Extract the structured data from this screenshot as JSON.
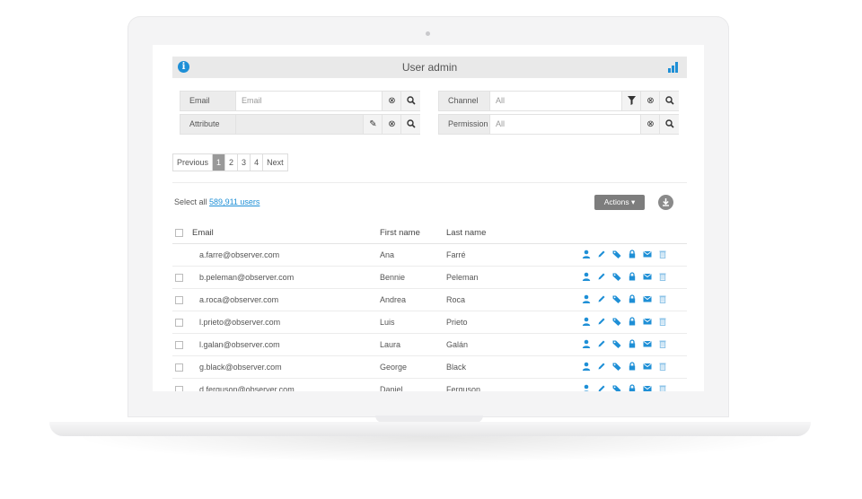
{
  "header": {
    "title": "User admin",
    "info_icon": "info-icon",
    "chart_icon": "bar-chart-icon"
  },
  "filters": {
    "email": {
      "label": "Email",
      "placeholder": "Email"
    },
    "attribute": {
      "label": "Attribute"
    },
    "channel": {
      "label": "Channel",
      "placeholder": "All"
    },
    "permission": {
      "label": "Permission",
      "placeholder": "All"
    }
  },
  "pagination": {
    "previous": "Previous",
    "pages": [
      "1",
      "2",
      "3",
      "4"
    ],
    "current": "1",
    "next": "Next"
  },
  "selection": {
    "prefix": "Select all",
    "count_link": "589,911 users"
  },
  "toolbar": {
    "actions_label": "Actions"
  },
  "table": {
    "columns": [
      "Email",
      "First name",
      "Last name"
    ],
    "rows": [
      {
        "email": "a.farre@observer.com",
        "first": "Ana",
        "last": "Farré"
      },
      {
        "email": "b.peleman@observer.com",
        "first": "Bennie",
        "last": "Peleman"
      },
      {
        "email": "a.roca@observer.com",
        "first": "Andrea",
        "last": "Roca"
      },
      {
        "email": "l.prieto@observer.com",
        "first": "Luis",
        "last": "Prieto"
      },
      {
        "email": "l.galan@observer.com",
        "first": "Laura",
        "last": "Galán"
      },
      {
        "email": "g.black@observer.com",
        "first": "George",
        "last": "Black"
      },
      {
        "email": "d.ferguson@observer.com",
        "first": "Daniel",
        "last": "Ferguson"
      }
    ],
    "row_action_icons": [
      "user-icon",
      "edit-icon",
      "tag-icon",
      "lock-icon",
      "mail-icon",
      "trash-icon"
    ]
  },
  "colors": {
    "accent": "#1e8fd6",
    "titlebar": "#e9e9e9",
    "actions_button": "#7d7d7d"
  }
}
